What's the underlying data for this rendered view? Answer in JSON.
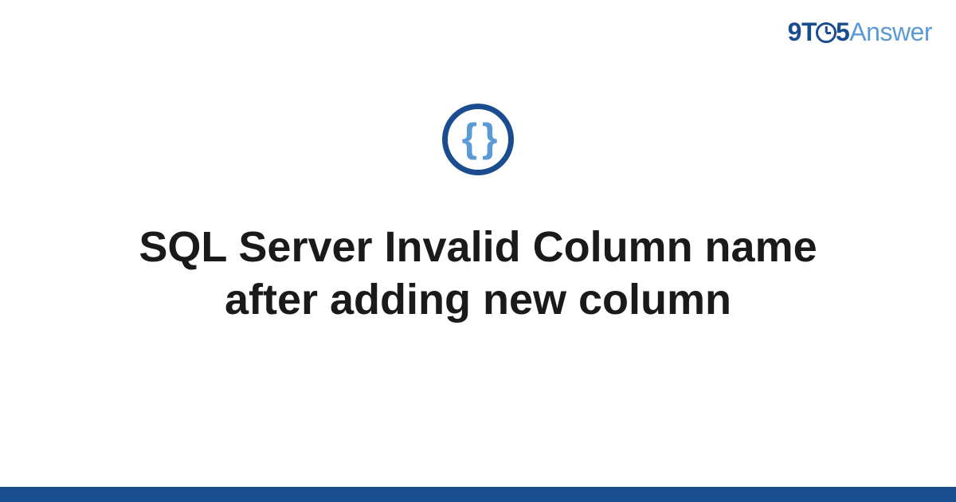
{
  "logo": {
    "part1": "9",
    "part2": "T",
    "part3": "5",
    "part4": "Answer"
  },
  "icon": {
    "glyph": "{ }",
    "name": "code-braces-icon"
  },
  "title": "SQL Server Invalid Column name after adding new column",
  "colors": {
    "brand_dark": "#1a4d8f",
    "brand_light": "#5b9bd5",
    "text": "#1a1a1a",
    "background": "#ffffff"
  }
}
